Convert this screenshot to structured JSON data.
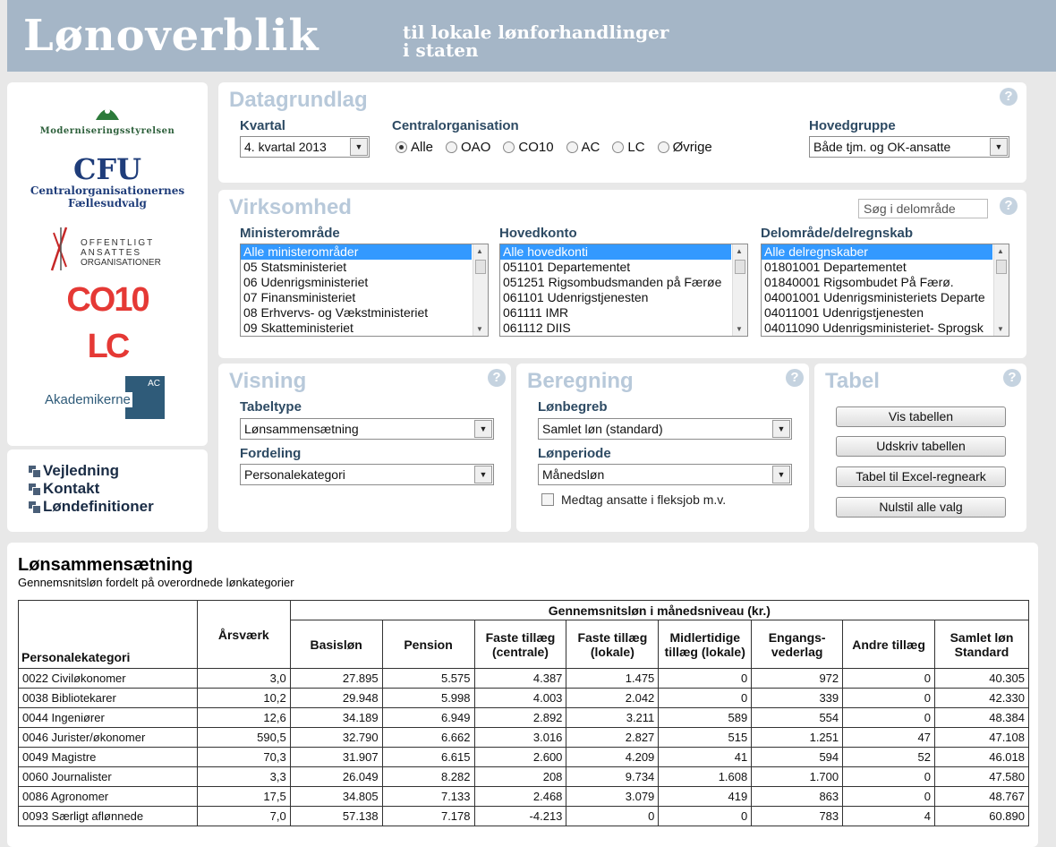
{
  "header": {
    "title": "Lønoverblik",
    "subtitle_line1": "til lokale lønforhandlinger",
    "subtitle_line2": "i staten"
  },
  "logos": {
    "modst": "Moderniseringsstyrelsen",
    "cfu": "CFU",
    "cfu_sub1": "Centralorganisationernes",
    "cfu_sub2": "Fællesudvalg",
    "oao_line1": "OFFENTLIGT",
    "oao_line2": "ANSATTES",
    "oao_line3": "ORGANISATIONER",
    "co10": "CO10",
    "lc": "LC",
    "ac_badge": "AC",
    "ac_name": "Akademikerne"
  },
  "links": [
    "Vejledning",
    "Kontakt",
    "Løndefinitioner"
  ],
  "datagrundlag": {
    "title": "Datagrundlag",
    "kvartal_label": "Kvartal",
    "kvartal_value": "4. kvartal 2013",
    "central_label": "Centralorganisation",
    "central_options": [
      "Alle",
      "OAO",
      "CO10",
      "AC",
      "LC",
      "Øvrige"
    ],
    "central_selected": "Alle",
    "hovedgruppe_label": "Hovedgruppe",
    "hovedgruppe_value": "Både tjm. og OK-ansatte"
  },
  "virksomhed": {
    "title": "Virksomhed",
    "search_placeholder": "Søg i delområde",
    "ministerium_label": "Ministerområde",
    "ministerium_items": [
      "Alle ministerområder",
      "05 Statsministeriet",
      "06 Udenrigsministeriet",
      "07 Finansministeriet",
      "08 Erhvervs- og Vækstministeriet",
      "09 Skatteministeriet"
    ],
    "hovedkonto_label": "Hovedkonto",
    "hovedkonto_items": [
      "Alle hovedkonti",
      "051101 Departementet",
      "051251 Rigsombudsmanden på Færøe",
      "061101 Udenrigstjenesten",
      "061111 IMR",
      "061112 DIIS"
    ],
    "delomraade_label": "Delområde/delregnskab",
    "delomraade_items": [
      "Alle delregnskaber",
      "01801001 Departementet",
      "01840001 Rigsombudet På Færø.",
      "04001001 Udenrigsministeriets Departe",
      "04011001 Udenrigstjenesten",
      "04011090 Udenrigsministeriet- Sprogsk"
    ]
  },
  "visning": {
    "title": "Visning",
    "tabeltype_label": "Tabeltype",
    "tabeltype_value": "Lønsammensætning",
    "fordeling_label": "Fordeling",
    "fordeling_value": "Personalekategori"
  },
  "beregning": {
    "title": "Beregning",
    "loenbegreb_label": "Lønbegreb",
    "loenbegreb_value": "Samlet løn (standard)",
    "loenperiode_label": "Lønperiode",
    "loenperiode_value": "Månedsløn",
    "checkbox_label": "Medtag ansatte i fleksjob m.v."
  },
  "tabel": {
    "title": "Tabel",
    "buttons": [
      "Vis tabellen",
      "Udskriv tabellen",
      "Tabel til Excel-regneark",
      "Nulstil alle valg"
    ]
  },
  "table": {
    "title": "Lønsammensætning",
    "subtitle": "Gennemsnitsløn fordelt på overordnede lønkategorier",
    "group_header": "Gennemsnitsløn i månedsniveau (kr.)",
    "col_personale": "Personalekategori",
    "col_aarsvaerk": "Årsværk",
    "columns": [
      "Basisløn",
      "Pension",
      "Faste tillæg (centrale)",
      "Faste tillæg (lokale)",
      "Midlertidige tillæg (lokale)",
      "Engangs-vederlag",
      "Andre tillæg",
      "Samlet løn Standard"
    ],
    "rows": [
      [
        "0022 Civiløkonomer",
        "3,0",
        "27.895",
        "5.575",
        "4.387",
        "1.475",
        "0",
        "972",
        "0",
        "40.305"
      ],
      [
        "0038 Bibliotekarer",
        "10,2",
        "29.948",
        "5.998",
        "4.003",
        "2.042",
        "0",
        "339",
        "0",
        "42.330"
      ],
      [
        "0044 Ingeniører",
        "12,6",
        "34.189",
        "6.949",
        "2.892",
        "3.211",
        "589",
        "554",
        "0",
        "48.384"
      ],
      [
        "0046 Jurister/økonomer",
        "590,5",
        "32.790",
        "6.662",
        "3.016",
        "2.827",
        "515",
        "1.251",
        "47",
        "47.108"
      ],
      [
        "0049 Magistre",
        "70,3",
        "31.907",
        "6.615",
        "2.600",
        "4.209",
        "41",
        "594",
        "52",
        "46.018"
      ],
      [
        "0060 Journalister",
        "3,3",
        "26.049",
        "8.282",
        "208",
        "9.734",
        "1.608",
        "1.700",
        "0",
        "47.580"
      ],
      [
        "0086 Agronomer",
        "17,5",
        "34.805",
        "7.133",
        "2.468",
        "3.079",
        "419",
        "863",
        "0",
        "48.767"
      ],
      [
        "0093 Særligt aflønnede",
        "7,0",
        "57.138",
        "7.178",
        "-4.213",
        "0",
        "0",
        "783",
        "4",
        "60.890"
      ]
    ]
  }
}
